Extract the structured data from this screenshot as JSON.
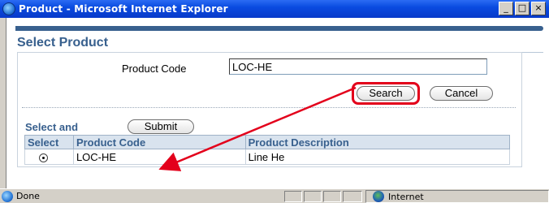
{
  "window": {
    "title": "Product - Microsoft Internet Explorer",
    "minimize": "_",
    "maximize": "□",
    "close": "×"
  },
  "page": {
    "title": "Select Product"
  },
  "search": {
    "label": "Product Code",
    "value": "LOC-HE",
    "search_button": "Search",
    "cancel_button": "Cancel"
  },
  "results": {
    "select_label": "Select and",
    "submit_button": "Submit",
    "columns": [
      "Select",
      "Product Code",
      "Product Description"
    ],
    "rows": [
      {
        "selected": true,
        "code": "LOC-HE",
        "description": "Line He"
      }
    ]
  },
  "statusbar": {
    "status": "Done",
    "zone": "Internet"
  },
  "colors": {
    "accent": "#38608e",
    "highlight": "#e3001b"
  }
}
